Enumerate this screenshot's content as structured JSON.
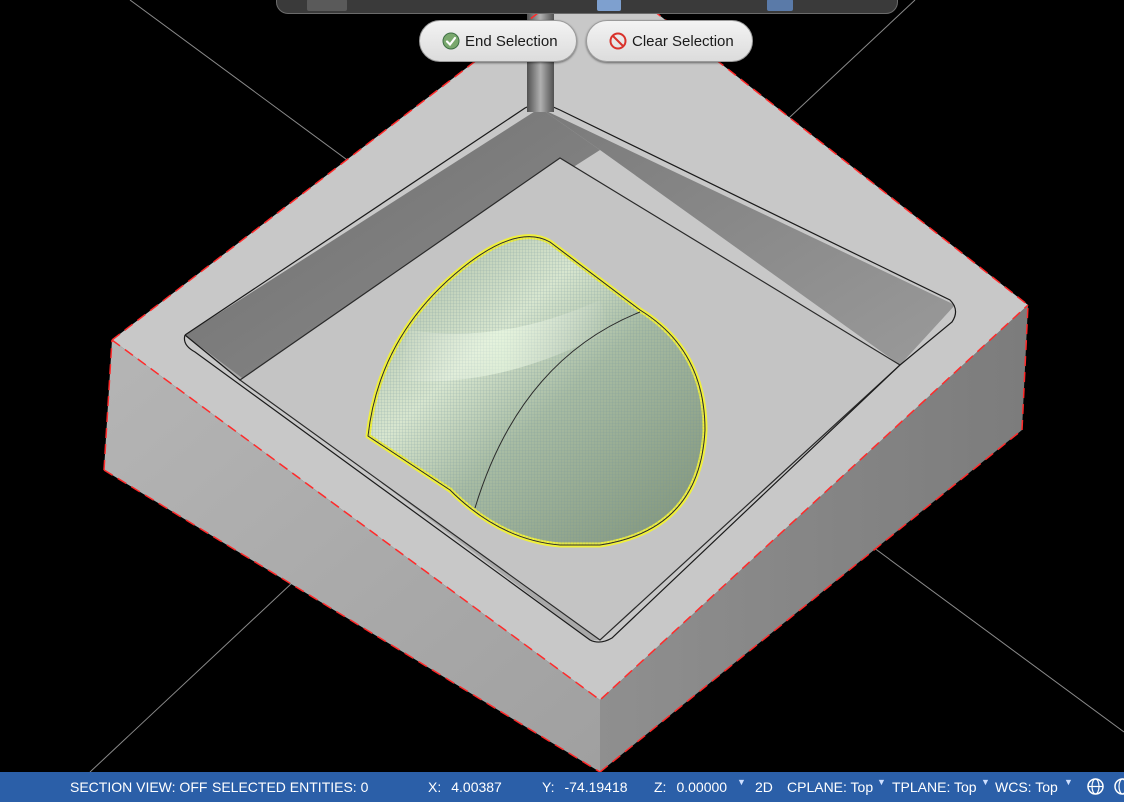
{
  "toolbar": {
    "end_selection": "End Selection",
    "clear_selection": "Clear Selection",
    "end_icon": "check-circle-icon",
    "clear_icon": "no-entry-icon"
  },
  "status": {
    "section_view": "SECTION VIEW: OFF",
    "selected_entities": "SELECTED ENTITIES: 0",
    "x_label": "X:",
    "x_value": "4.00387",
    "y_label": "Y:",
    "y_value": "-74.19418",
    "z_label": "Z:",
    "z_value": "0.00000",
    "mode": "2D",
    "cplane": "CPLANE: Top",
    "tplane": "TPLANE: Top",
    "wcs": "WCS: Top",
    "icons": [
      "globe-icon",
      "globe-icon"
    ]
  },
  "colors": {
    "statusbar": "#2b5fa8",
    "viewport_bg": "#000000",
    "selection_highlight": "#f0f03c",
    "boundary_dash": "#ff2a2a",
    "selected_surface": "#8fa58c"
  },
  "scene": {
    "model": "rectangular pocket block with domed boss",
    "selection": "highlighted dome surface"
  }
}
